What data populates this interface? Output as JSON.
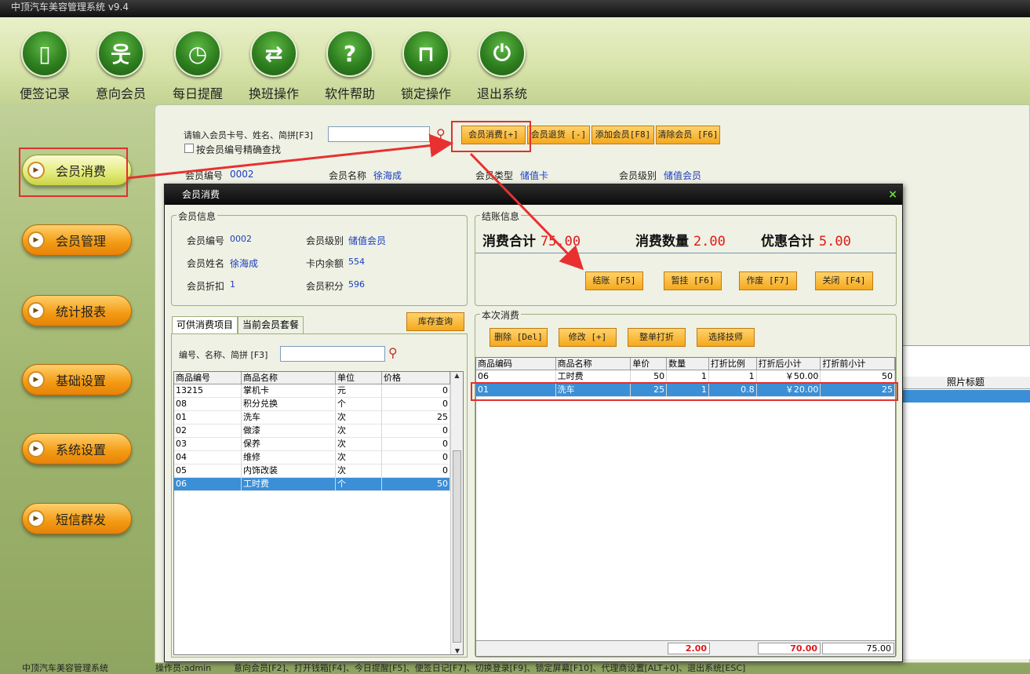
{
  "app": {
    "title": "中顶汽车美容管理系统 v9.4"
  },
  "toolbar": [
    {
      "label": "便签记录",
      "icon": "note-icon"
    },
    {
      "label": "意向会员",
      "icon": "person-icon"
    },
    {
      "label": "每日提醒",
      "icon": "alarm-clock-icon"
    },
    {
      "label": "换班操作",
      "icon": "swap-arrows-icon"
    },
    {
      "label": "软件帮助",
      "icon": "help-icon"
    },
    {
      "label": "锁定操作",
      "icon": "lock-icon"
    },
    {
      "label": "退出系统",
      "icon": "power-icon"
    }
  ],
  "nav": [
    {
      "label": "会员消费",
      "active": true
    },
    {
      "label": "会员管理"
    },
    {
      "label": "统计报表"
    },
    {
      "label": "基础设置"
    },
    {
      "label": "系统设置"
    },
    {
      "label": "短信群发"
    }
  ],
  "search": {
    "label": "请输入会员卡号、姓名、简拼[F3]",
    "value": "",
    "exact_label": "按会员编号精确查找"
  },
  "actions": {
    "consume": "会员消费[+]",
    "return": "会员退货 [-]",
    "add": "添加会员[F8]",
    "clear": "清除会员 [F6]"
  },
  "member_bar": {
    "id_label": "会员编号",
    "id": "0002",
    "name_label": "会员名称",
    "name": "徐海成",
    "type_label": "会员类型",
    "type": "储值卡",
    "level_label": "会员级别",
    "level": "储值会员"
  },
  "bg_table": {
    "photo_col": "照片标题"
  },
  "dialog": {
    "title": "会员消费",
    "close": "×",
    "member_info": {
      "title": "会员信息",
      "id_label": "会员编号",
      "id": "0002",
      "level_label": "会员级别",
      "level": "储值会员",
      "name_label": "会员姓名",
      "name": "徐海成",
      "balance_label": "卡内余额",
      "balance": "554",
      "discount_label": "会员折扣",
      "discount": "1",
      "points_label": "会员积分",
      "points": "596"
    },
    "checkout": {
      "title": "结账信息",
      "total_label": "消费合计",
      "total": "75.00",
      "qty_label": "消费数量",
      "qty": "2.00",
      "discount_label": "优惠合计",
      "discount": "5.00",
      "settle": "结账 [F5]",
      "hold": "暂挂 [F6]",
      "void": "作废 [F7]",
      "close": "关闭 [F4]"
    },
    "tabs": {
      "items": "可供消费项目",
      "packages": "当前会员套餐"
    },
    "stock_btn": "库存查询",
    "item_search_label": "编号、名称、简拼 [F3]",
    "item_search_value": "",
    "items_table": {
      "headers": [
        "商品编号",
        "商品名称",
        "单位",
        "价格"
      ],
      "rows": [
        [
          "13215",
          "掌机卡",
          "元",
          "0"
        ],
        [
          "08",
          "积分兑换",
          "个",
          "0"
        ],
        [
          "01",
          "洗车",
          "次",
          "25"
        ],
        [
          "02",
          "做漆",
          "次",
          "0"
        ],
        [
          "03",
          "保养",
          "次",
          "0"
        ],
        [
          "04",
          "维修",
          "次",
          "0"
        ],
        [
          "05",
          "内饰改装",
          "次",
          "0"
        ],
        [
          "06",
          "工时费",
          "个",
          "50"
        ]
      ],
      "selected_index": 7
    },
    "current": {
      "title": "本次消费",
      "delete": "删除 [Del]",
      "modify": "修改 [+]",
      "discount_all": "整单打折",
      "technician": "选择技师",
      "headers": [
        "商品编码",
        "商品名称",
        "单价",
        "数量",
        "打折比例",
        "打折后小计",
        "打折前小计"
      ],
      "rows": [
        [
          "06",
          "工时费",
          "50",
          "1",
          "1",
          "￥50.00",
          "50"
        ],
        [
          "01",
          "洗车",
          "25",
          "1",
          "0.8",
          "￥20.00",
          "25"
        ]
      ],
      "selected_index": 1,
      "footer_qty": "2.00",
      "footer_after": "70.00",
      "footer_before": "75.00"
    }
  },
  "status": {
    "app": "中顶汽车美容管理系统",
    "operator": "操作员:admin",
    "shortcuts": "意向会员[F2]、打开钱箱[F4]、今日提醒[F5]、便签日记[F7]、切换登录[F9]、锁定屏幕[F10]、代理商设置[ALT+0]、退出系统[ESC]"
  }
}
